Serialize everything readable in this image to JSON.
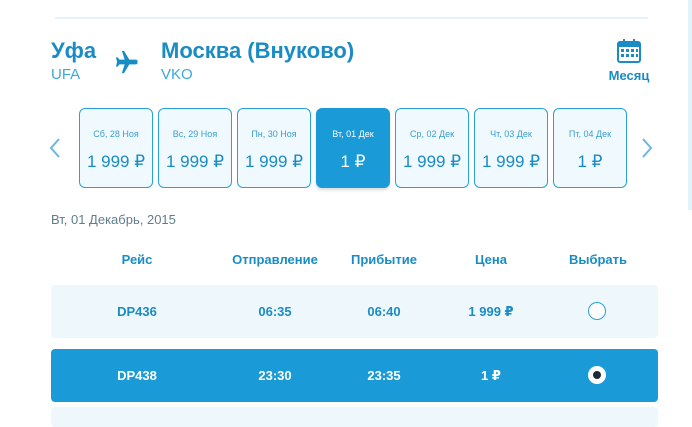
{
  "route": {
    "from_city": "Уфа",
    "from_code": "UFA",
    "to_city": "Москва (Внуково)",
    "to_code": "VKO"
  },
  "month_button": {
    "label": "Месяц",
    "icon": "calendar-icon"
  },
  "days": [
    {
      "label": "Сб, 28 Ноя",
      "price": "1 999 ₽",
      "active": false
    },
    {
      "label": "Вс, 29 Ноя",
      "price": "1 999 ₽",
      "active": false
    },
    {
      "label": "Пн, 30 Ноя",
      "price": "1 999 ₽",
      "active": false
    },
    {
      "label": "Вт, 01 Дек",
      "price": "1 ₽",
      "active": true
    },
    {
      "label": "Ср, 02 Дек",
      "price": "1 999 ₽",
      "active": false
    },
    {
      "label": "Чт, 03 Дек",
      "price": "1 999 ₽",
      "active": false
    },
    {
      "label": "Пт, 04 Дек",
      "price": "1 ₽",
      "active": false
    }
  ],
  "selected_date": "Вт, 01 Декабрь, 2015",
  "table": {
    "headers": [
      "Рейс",
      "Отправление",
      "Прибытие",
      "Цена",
      "Выбрать"
    ],
    "rows": [
      {
        "flight": "DP436",
        "departure": "06:35",
        "arrival": "06:40",
        "price": "1 999 ₽",
        "selected": false
      },
      {
        "flight": "DP438",
        "departure": "23:30",
        "arrival": "23:35",
        "price": "1 ₽",
        "selected": true
      }
    ]
  },
  "colors": {
    "accent": "#1a9ad6",
    "text_blue": "#1a8cc4",
    "row_bg": "#eef7fc"
  }
}
